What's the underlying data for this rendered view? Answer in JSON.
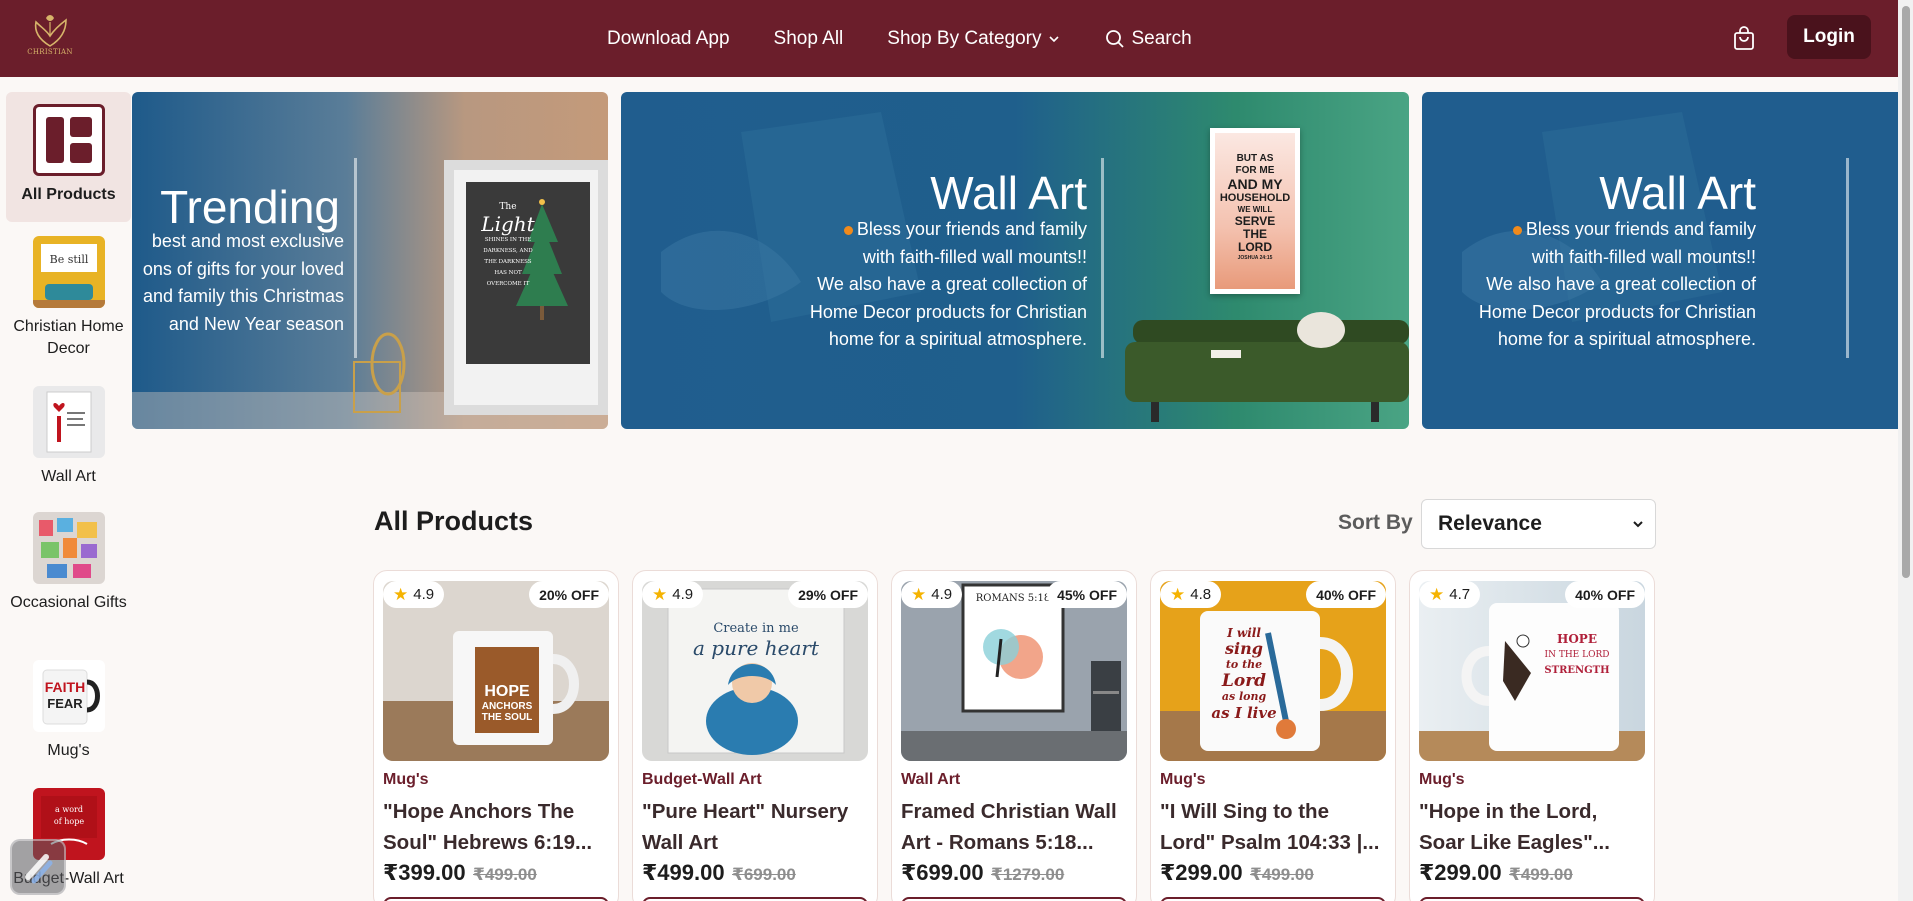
{
  "header": {
    "logo_text": "CHRISTIAN",
    "nav": [
      "Download App",
      "Shop All",
      "Shop By Category",
      "Search"
    ],
    "login_label": "Login"
  },
  "sidebar": {
    "items": [
      {
        "label": "All Products",
        "active": true
      },
      {
        "label": "Christian Home Decor"
      },
      {
        "label": "Wall Art"
      },
      {
        "label": "Occasional Gifts"
      },
      {
        "label": "Mug's"
      },
      {
        "label": "Budget-Wall Art"
      }
    ]
  },
  "banners": [
    {
      "title": "Trending",
      "text": "best and most exclusive ons of gifts for your loved and family this Christmas and New Year season",
      "lines": [
        "best and most exclusive",
        "ons of gifts for your loved",
        "and family this Christmas",
        "and New Year season"
      ]
    },
    {
      "title": "Wall Art",
      "lines": [
        "Bless your friends and family",
        "with faith-filled wall mounts!!",
        "We also have a great collection of",
        "Home Decor products for Christian",
        "home for a spiritual atmosphere."
      ]
    },
    {
      "title": "Wall Art",
      "lines": [
        "Bless your friends and family",
        "with faith-filled wall mounts!!",
        "We also have a great collection of",
        "Home Decor products for Christian",
        "home for a spiritual atmosphere."
      ]
    }
  ],
  "poster1_lines": [
    "The",
    "Light",
    "SHINES IN THE",
    "DARKNESS, AND",
    "THE DARKNESS",
    "HAS NOT",
    "OVERCOME IT"
  ],
  "poster2_lines": [
    "BUT AS",
    "FOR ME",
    "AND MY",
    "HOUSEHOLD",
    "WE WILL",
    "SERVE",
    "THE",
    "LORD",
    "JOSHUA 24:15"
  ],
  "products_heading": "All Products",
  "sort": {
    "label": "Sort By",
    "value": "Relevance"
  },
  "products": [
    {
      "rating": "4.9",
      "off": "20% OFF",
      "category": "Mug's",
      "name1": "\"Hope Anchors The",
      "name2": "Soul\" Hebrews 6:19...",
      "price": "₹399.00",
      "mrp": "₹499.00",
      "mug_text": [
        "HOPE",
        "ANCHORS",
        "THE SOUL"
      ]
    },
    {
      "rating": "4.9",
      "off": "29% OFF",
      "category": "Budget-Wall Art",
      "name1": "\"Pure Heart\" Nursery",
      "name2": "Wall Art",
      "price": "₹499.00",
      "mrp": "₹699.00",
      "art_text": [
        "Create in me",
        "a pure heart"
      ]
    },
    {
      "rating": "4.9",
      "off": "45% OFF",
      "category": "Wall Art",
      "name1": "Framed Christian Wall",
      "name2": "Art - Romans 5:18...",
      "price": "₹699.00",
      "mrp": "₹1279.00",
      "art_text": [
        "ROMANS 5:18"
      ]
    },
    {
      "rating": "4.8",
      "off": "40% OFF",
      "category": "Mug's",
      "name1": "\"I Will Sing to the",
      "name2": "Lord\" Psalm 104:33 |...",
      "price": "₹299.00",
      "mrp": "₹499.00",
      "mug_text": [
        "I will",
        "sing",
        "to the",
        "Lord",
        "as long",
        "as I live"
      ]
    },
    {
      "rating": "4.7",
      "off": "40% OFF",
      "category": "Mug's",
      "name1": "\"Hope in the Lord,",
      "name2": "Soar Like Eagles\"...",
      "price": "₹299.00",
      "mrp": "₹499.00",
      "mug_text": [
        "HOPE",
        "IN THE LORD",
        "STRENGTH"
      ]
    }
  ]
}
